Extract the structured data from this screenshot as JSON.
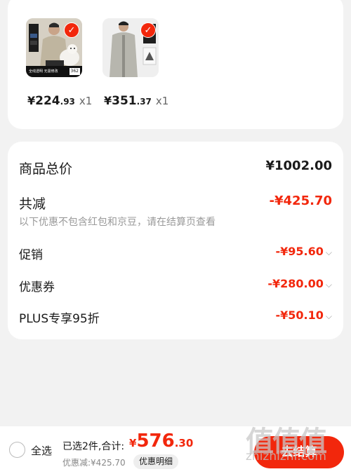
{
  "items": [
    {
      "price_yen": "¥",
      "price_int": "224",
      "price_dec": ".93",
      "qty": "x1",
      "banner_text": "全线透明 无需修改",
      "banner_badge": "362"
    },
    {
      "price_yen": "¥",
      "price_int": "351",
      "price_dec": ".37",
      "qty": "x1"
    }
  ],
  "summary": {
    "total_label": "商品总价",
    "total_value": "¥1002.00",
    "discount_label": "共减",
    "discount_value": "-¥425.70",
    "discount_note": "以下优惠不包含红包和京豆，请在结算页查看",
    "rows": [
      {
        "label": "促销",
        "value": "-¥95.60"
      },
      {
        "label": "优惠券",
        "value": "-¥280.00"
      },
      {
        "label": "PLUS专享95折",
        "value": "-¥50.10"
      }
    ]
  },
  "bottom": {
    "select_all": "全选",
    "selected_info": "已选2件,合计:",
    "total_yen": "¥",
    "total_int": "576",
    "total_dec": ".30",
    "discount_line": "优惠减:¥425.70",
    "detail_button": "优惠明细",
    "checkout_button": "去结算"
  },
  "watermark": {
    "chars": "值值值",
    "url": "zhizhizhi.com"
  },
  "colors": {
    "accent": "#f2270c",
    "background": "#f2f2f2"
  },
  "icons": {
    "check": "check-icon",
    "chevron": "chevron-down-icon"
  }
}
